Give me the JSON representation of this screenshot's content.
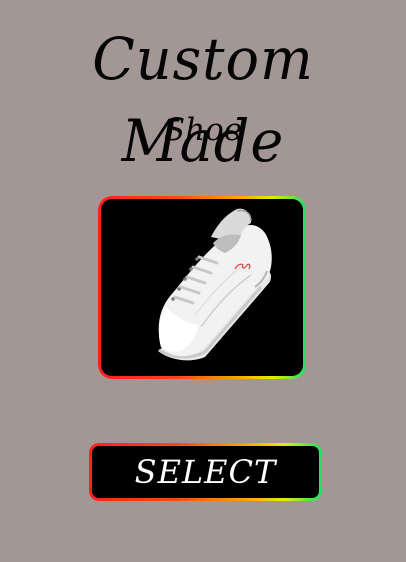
{
  "header": {
    "title": "Custom Made",
    "subtitle": "Shoe"
  },
  "product": {
    "image_icon": "sneaker-image",
    "frame_colors": [
      "#ff1f1f",
      "#f54a16",
      "#ffb400",
      "#e0ef00",
      "#19e06a"
    ]
  },
  "actions": {
    "select_label": "SELECT"
  },
  "theme": {
    "background": "#a39796",
    "panel": "#000000",
    "text": "#050505",
    "button_text": "#ffffff"
  }
}
